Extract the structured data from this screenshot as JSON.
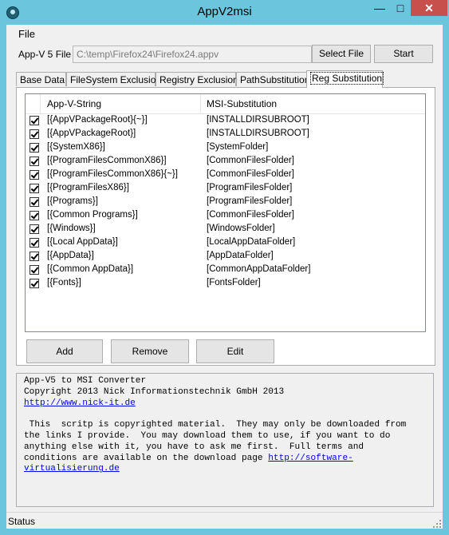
{
  "window": {
    "title": "AppV2msi"
  },
  "menu": {
    "file": "File"
  },
  "form": {
    "appv_label": "App-V 5 File",
    "path_value": "C:\\temp\\Firefox24\\Firefox24.appv",
    "select_file": "Select File",
    "start": "Start"
  },
  "tabs": [
    {
      "label": "Base Data"
    },
    {
      "label": "FileSystem Exclusion"
    },
    {
      "label": "Registry Exclusion"
    },
    {
      "label": "PathSubstitution"
    },
    {
      "label": "Reg Substitution"
    }
  ],
  "active_tab": "Reg Substitution",
  "table": {
    "col1": "App-V-String",
    "col2": "MSI-Substitution",
    "rows": [
      {
        "checked": true,
        "appv": "[{AppVPackageRoot}{~}]",
        "msi": "[INSTALLDIRSUBROOT]"
      },
      {
        "checked": true,
        "appv": "[{AppVPackageRoot}]",
        "msi": "[INSTALLDIRSUBROOT]"
      },
      {
        "checked": true,
        "appv": "[{SystemX86}]",
        "msi": "[SystemFolder]"
      },
      {
        "checked": true,
        "appv": "[{ProgramFilesCommonX86}]",
        "msi": "[CommonFilesFolder]"
      },
      {
        "checked": true,
        "appv": "[{ProgramFilesCommonX86}{~}]",
        "msi": "[CommonFilesFolder]"
      },
      {
        "checked": true,
        "appv": "[{ProgramFilesX86}]",
        "msi": "[ProgramFilesFolder]"
      },
      {
        "checked": true,
        "appv": "[{Programs}]",
        "msi": "[ProgramFilesFolder]"
      },
      {
        "checked": true,
        "appv": "[{Common Programs}]",
        "msi": "[CommonFilesFolder]"
      },
      {
        "checked": true,
        "appv": "[{Windows}]",
        "msi": "[WindowsFolder]"
      },
      {
        "checked": true,
        "appv": "[{Local AppData}]",
        "msi": "[LocalAppDataFolder]"
      },
      {
        "checked": true,
        "appv": "[{AppData}]",
        "msi": "[AppDataFolder]"
      },
      {
        "checked": true,
        "appv": "[{Common AppData}]",
        "msi": "[CommonAppDataFolder]"
      },
      {
        "checked": true,
        "appv": "[{Fonts}]",
        "msi": "[FontsFolder]"
      }
    ]
  },
  "buttons": {
    "add": "Add",
    "remove": "Remove",
    "edit": "Edit"
  },
  "info": {
    "line1": "App-V5 to MSI Converter",
    "line2": "Copyright 2013 Nick Informationstechnik GmbH 2013",
    "link1": "http://www.nick-it.de",
    "para": " This  scritp is copyrighted material.  They may only be downloaded from\nthe links I provide.  You may download them to use, if you want to do\nanything else with it, you have to ask me first.  Full terms and\nconditions are available on the download page ",
    "link2_part1": "http://software-",
    "link2_part2": "virtualisierung.de"
  },
  "status": {
    "text": "Status"
  },
  "colors": {
    "title_bar": "#6bc6dd",
    "close_button": "#c7504c",
    "link": "#0000ee"
  }
}
